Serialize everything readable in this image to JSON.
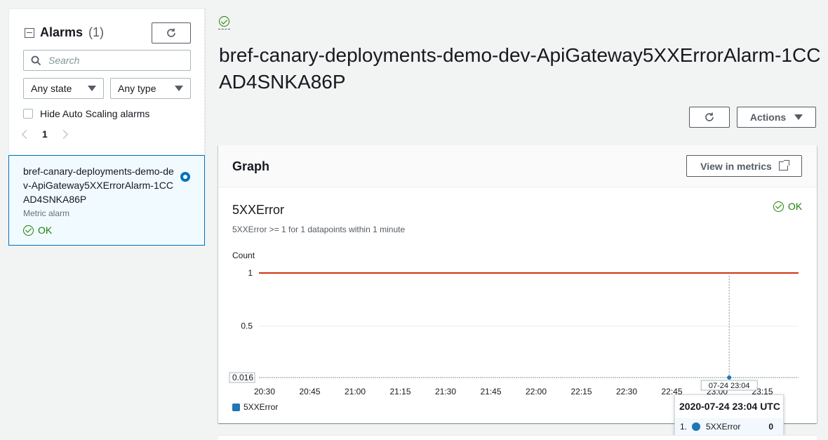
{
  "sidebar": {
    "title": "Alarms",
    "count": "(1)",
    "search_placeholder": "Search",
    "state_filter": "Any state",
    "type_filter": "Any type",
    "hide_autoscaling_label": "Hide Auto Scaling alarms",
    "page": "1",
    "alarm": {
      "name": "bref-canary-deployments-demo-dev-ApiGateway5XXErrorAlarm-1CCAD4SNKA86P",
      "type": "Metric alarm",
      "status": "OK"
    }
  },
  "main": {
    "title": "bref-canary-deployments-demo-dev-ApiGateway5XXErrorAlarm-1CCAD4SNKA86P",
    "actions_label": "Actions",
    "graph": {
      "title": "Graph",
      "view_metrics_label": "View in metrics",
      "metric_name": "5XXError",
      "status": "OK",
      "condition": "5XXError >= 1 for 1 datapoints within 1 minute",
      "ylabel": "Count",
      "legend": "5XXError"
    },
    "tooltip": {
      "time": "2020-07-24 23:04 UTC",
      "index": "1.",
      "series": "5XXError",
      "value": "0"
    }
  },
  "colors": {
    "threshold": "#d13212",
    "series": "#1f77b4",
    "ok": "#1d8102",
    "accent": "#0073bb"
  },
  "icons": [
    "collapse-icon",
    "refresh-icon",
    "search-icon",
    "caret-down-icon",
    "chevron-left-icon",
    "chevron-right-icon",
    "ok-check-icon",
    "external-link-icon"
  ],
  "chart_data": {
    "type": "line",
    "ylabel": "Count",
    "x": [
      "20:30",
      "20:45",
      "21:00",
      "21:15",
      "21:30",
      "21:45",
      "22:00",
      "22:15",
      "22:30",
      "22:45",
      "23:00",
      "23:15"
    ],
    "yticks": [
      "1",
      "0.5",
      "0.016"
    ],
    "ylim": [
      0.016,
      1
    ],
    "threshold": 1,
    "series": [
      {
        "name": "5XXError",
        "points": [
          {
            "x": "23:04",
            "y": 0
          }
        ]
      }
    ],
    "hover_label": "07-24 23:04",
    "legend_position": "bottom-left"
  }
}
